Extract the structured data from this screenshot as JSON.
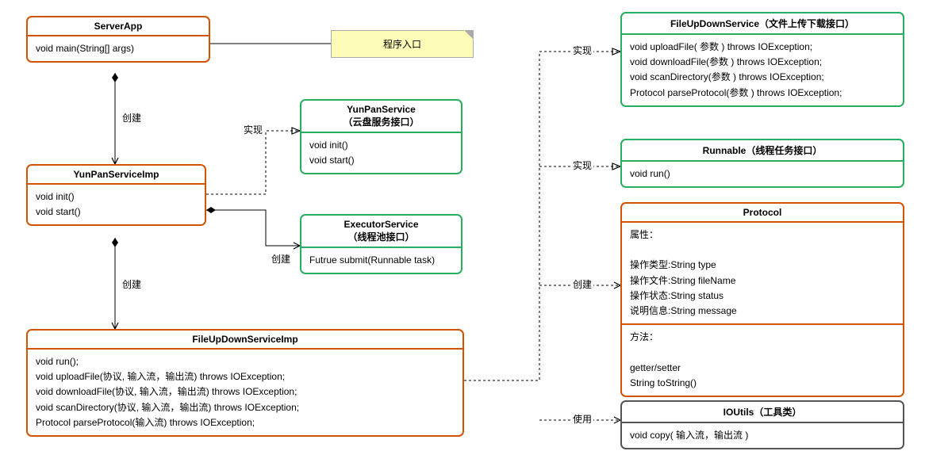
{
  "serverApp": {
    "title": "ServerApp",
    "body": "void  main(String[] args)"
  },
  "note": "程序入口",
  "yunPanServiceImp": {
    "title": "YunPanServiceImp",
    "body": "void  init()\nvoid  start()"
  },
  "yunPanService": {
    "title": "YunPanService\n（云盘服务接口）",
    "body": "void init()\nvoid start()"
  },
  "executorService": {
    "title": "ExecutorService\n（线程池接口）",
    "body": "Futrue submit(Runnable task)"
  },
  "fileUpDownServiceImp": {
    "title": "FileUpDownServiceImp",
    "body": "void run();\nvoid uploadFile(协议, 输入流，输出流) throws IOException;\nvoid downloadFile(协议, 输入流，输出流) throws IOException;\nvoid scanDirectory(协议, 输入流，输出流) throws IOException;\nProtocol parseProtocol(输入流) throws IOException;"
  },
  "fileUpDownService": {
    "title": "FileUpDownService（文件上传下载接口）",
    "body": "void uploadFile( 参数 ) throws IOException;\nvoid downloadFile(参数 ) throws IOException;\nvoid scanDirectory(参数 ) throws IOException;\nProtocol parseProtocol(参数 ) throws IOException;"
  },
  "runnable": {
    "title": "Runnable（线程任务接口）",
    "body": "void run()"
  },
  "protocol": {
    "title": "Protocol",
    "body1": "属性：\n\n操作类型:String type\n操作文件:String fileName\n操作状态:String status\n说明信息:String message",
    "body2": "方法：\n\ngetter/setter\nString toString()"
  },
  "ioUtils": {
    "title": "IOUtils（工具类）",
    "body": "void copy( 输入流，输出流 )"
  },
  "labels": {
    "create": "创建",
    "impl": "实现",
    "use": "使用"
  }
}
